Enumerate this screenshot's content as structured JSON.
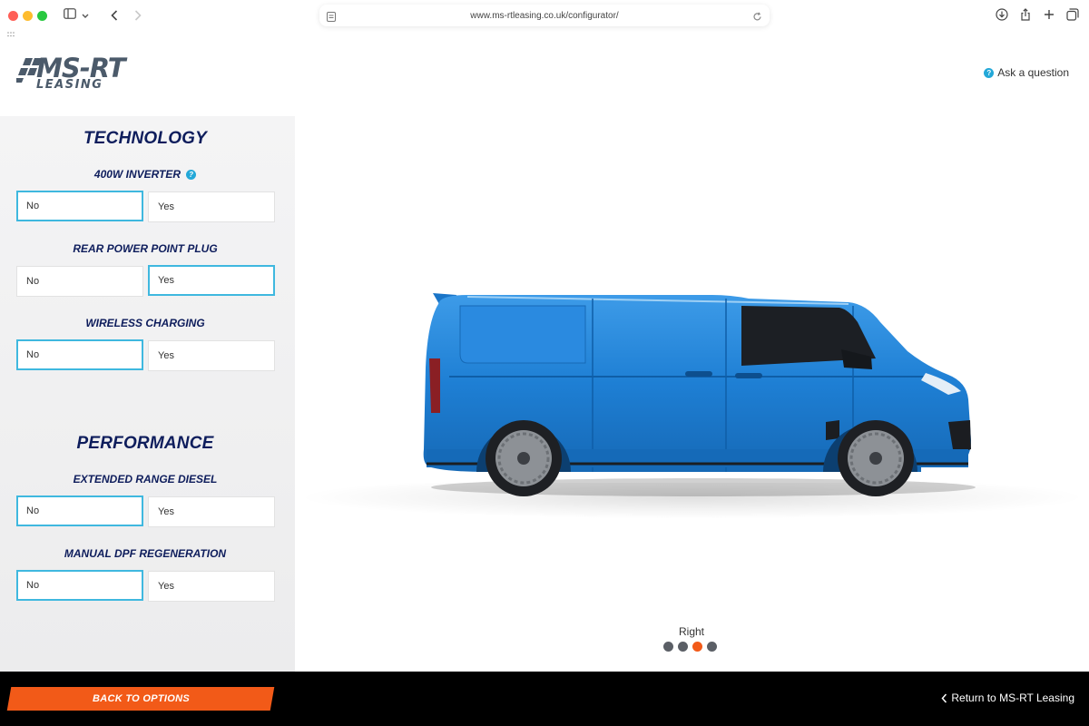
{
  "browser": {
    "url": "www.ms-rtleasing.co.uk/configurator/"
  },
  "logo": {
    "main": "MS-RT",
    "sub": "LEASING"
  },
  "header": {
    "ask_label": "Ask a question",
    "ask_badge": "?"
  },
  "technology": {
    "title": "TECHNOLOGY",
    "options": [
      {
        "label": "400W INVERTER",
        "no": "No",
        "yes": "Yes",
        "selected": "No",
        "has_help": true
      },
      {
        "label": "REAR POWER POINT PLUG",
        "no": "No",
        "yes": "Yes",
        "selected": "Yes"
      },
      {
        "label": "WIRELESS CHARGING",
        "no": "No",
        "yes": "Yes",
        "selected": "No"
      }
    ]
  },
  "performance": {
    "title": "PERFORMANCE",
    "options": [
      {
        "label": "EXTENDED RANGE DIESEL",
        "no": "No",
        "yes": "Yes",
        "selected": "No"
      },
      {
        "label": "MANUAL DPF REGENERATION",
        "no": "No",
        "yes": "Yes",
        "selected": "No"
      }
    ]
  },
  "viewer": {
    "view_label": "Right",
    "views_total": 4,
    "active_view_index": 2,
    "van_color": "#1e7fd4"
  },
  "footer": {
    "back_label": "BACK TO OPTIONS",
    "return_label": "Return to MS-RT Leasing"
  },
  "colors": {
    "navy": "#0e1d5c",
    "accent_orange": "#f25a18",
    "selected_border": "#3fb8df",
    "help_badge": "#23a8d8"
  }
}
